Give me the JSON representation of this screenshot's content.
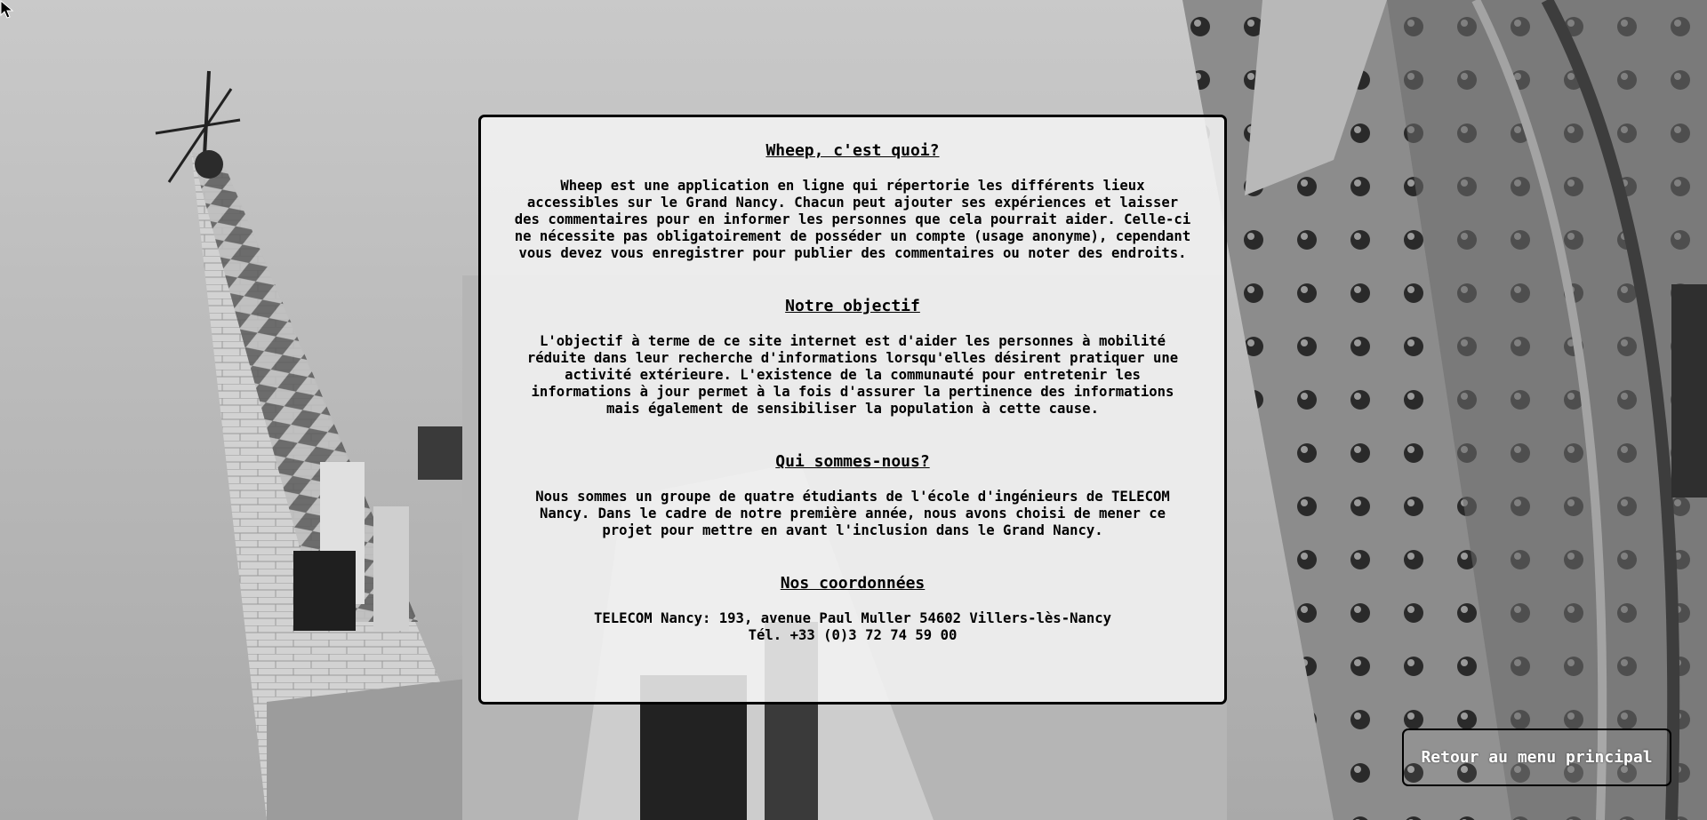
{
  "background": {
    "description_icon": "cathedral-photo"
  },
  "sections": [
    {
      "title": "Wheep, c'est quoi?",
      "text": "Wheep est une application en ligne qui répertorie les différents lieux\naccessibles sur le Grand Nancy. Chacun peut ajouter ses expériences et laisser\ndes commentaires pour en informer les personnes que cela pourrait aider. Celle-ci\nne nécessite pas obligatoirement de posséder un compte (usage anonyme), cependant\nvous devez vous enregistrer pour publier des commentaires ou noter des endroits."
    },
    {
      "title": "Notre objectif",
      "text": "L'objectif à terme de ce site internet est d'aider les personnes à mobilité\nréduite dans leur recherche d'informations lorsqu'elles désirent pratiquer une\nactivité extérieure. L'existence de la communauté pour entretenir les\ninformations à jour permet à la fois d'assurer la pertinence des informations\nmais également de sensibiliser la population à cette cause."
    },
    {
      "title": "Qui sommes-nous?",
      "text": "Nous sommes un groupe de quatre étudiants de l'école d'ingénieurs de TELECOM\nNancy. Dans le cadre de notre première année, nous avons choisi de mener ce\nprojet pour mettre en avant l'inclusion dans le Grand Nancy."
    },
    {
      "title": "Nos coordonnées",
      "text": "TELECOM Nancy: 193, avenue Paul Muller 54602 Villers-lès-Nancy\nTél. +33 (0)3 72 74 59 00"
    }
  ],
  "back_button": {
    "label": "Retour au menu principal"
  },
  "colors": {
    "panel_bg": "#f3f3f3",
    "border": "#000000",
    "button_text": "#ffffff"
  },
  "icons": {
    "cursor": "mouse-cursor-icon"
  }
}
